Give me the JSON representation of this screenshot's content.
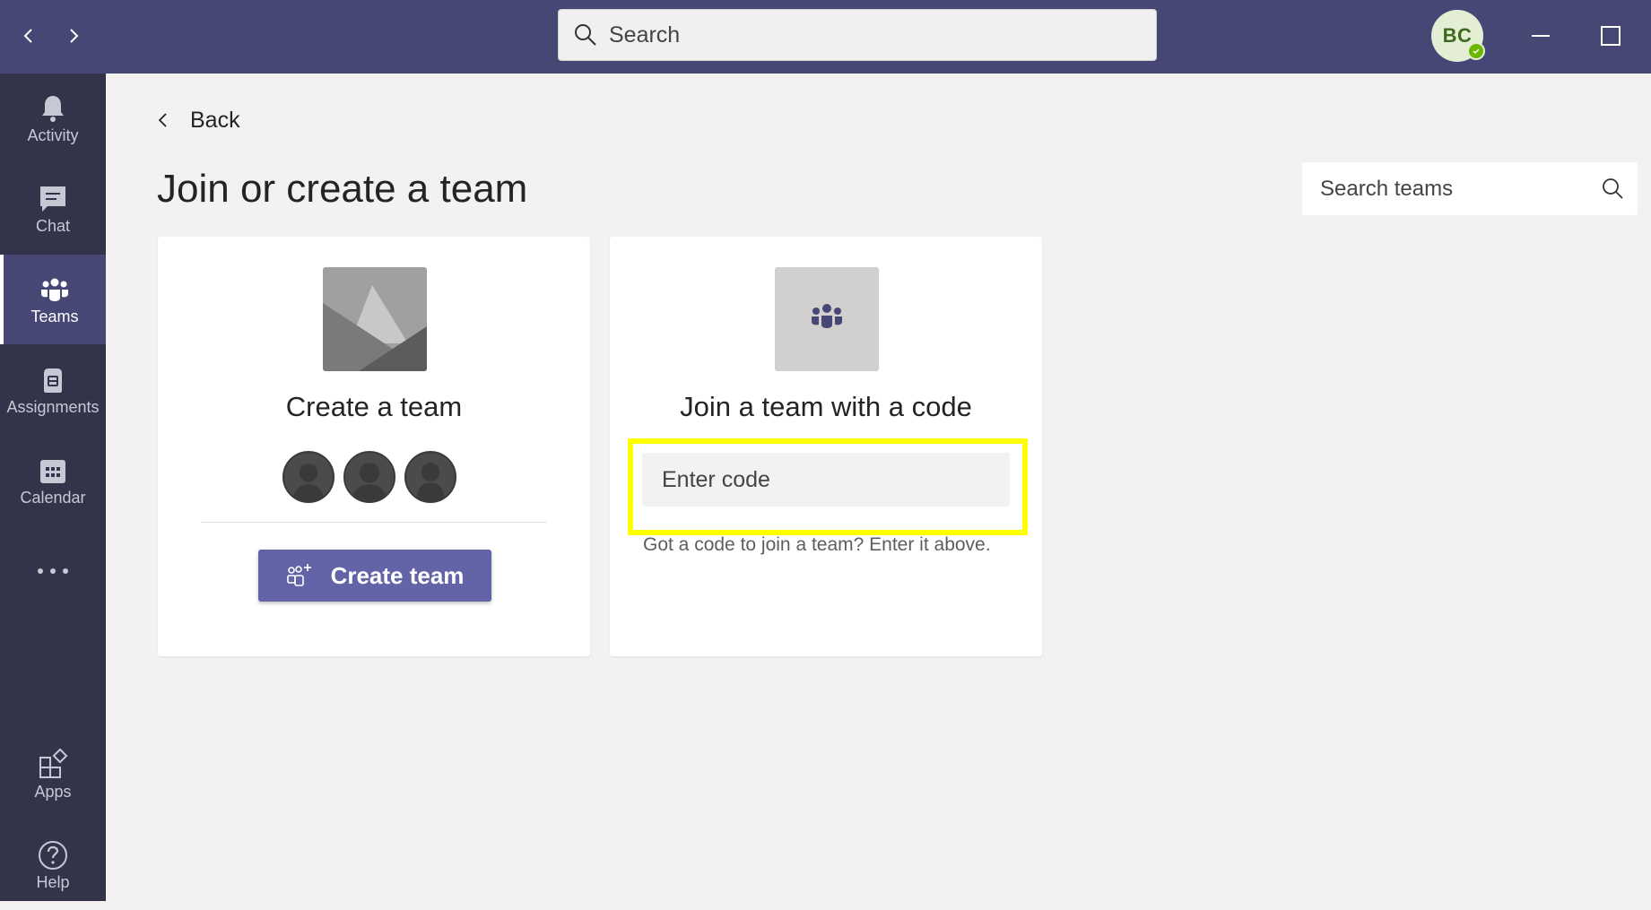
{
  "titlebar": {
    "search_placeholder": "Search",
    "avatar_initials": "BC",
    "presence_status": "available",
    "colors": {
      "background": "#464775",
      "presence": "#6bb700"
    }
  },
  "rail": {
    "items": [
      {
        "label": "Activity",
        "icon": "bell-icon"
      },
      {
        "label": "Chat",
        "icon": "chat-icon"
      },
      {
        "label": "Teams",
        "icon": "teams-icon",
        "active": true
      },
      {
        "label": "Assignments",
        "icon": "assignments-icon"
      },
      {
        "label": "Calendar",
        "icon": "calendar-icon"
      },
      {
        "label": "Apps",
        "icon": "apps-icon"
      },
      {
        "label": "Help",
        "icon": "help-icon"
      }
    ],
    "more_icon": "more-icon"
  },
  "main": {
    "back_label": "Back",
    "page_title": "Join or create a team",
    "search_teams_placeholder": "Search teams",
    "create_card": {
      "title": "Create a team",
      "button_label": "Create team"
    },
    "join_card": {
      "title": "Join a team with a code",
      "code_placeholder": "Enter code",
      "hint": "Got a code to join a team? Enter it above."
    },
    "colors": {
      "accent": "#6264a7",
      "highlight": "#ffff00"
    }
  }
}
